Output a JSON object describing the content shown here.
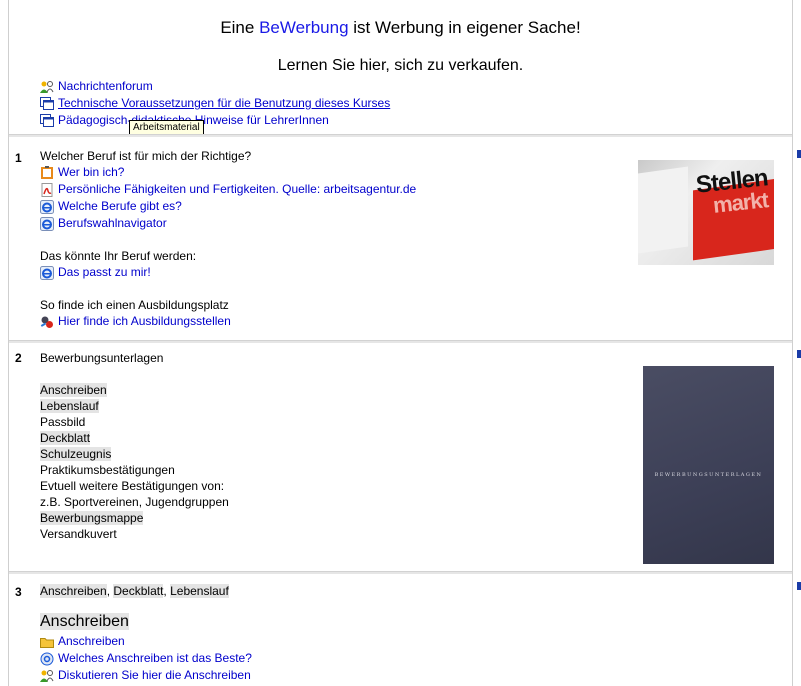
{
  "header": {
    "title_pre": "Eine ",
    "title_brand": "BeWerbung",
    "title_post": " ist Werbung in eigener Sache!",
    "subtitle": "Lernen Sie hier, sich zu verkaufen."
  },
  "intro_links": [
    {
      "label": "Nachrichtenforum",
      "icon": "forum-icon"
    },
    {
      "label": "Technische Voraussetzungen für die Benutzung dieses Kurses",
      "icon": "window-icon"
    },
    {
      "label": "Pädagogisch-didaktische Hinweise für LehrerInnen",
      "icon": "window-icon"
    }
  ],
  "tooltip": "Arbeitsmaterial",
  "section1": {
    "number": "1",
    "heading": "Welcher Beruf ist für mich der Richtige?",
    "links_a": [
      {
        "label": "Wer bin ich?",
        "icon": "clipboard-icon"
      },
      {
        "label": "Persönliche Fähigkeiten und Fertigkeiten. Quelle: arbeitsagentur.de",
        "icon": "pdf-icon"
      },
      {
        "label": "Welche Berufe gibt es?",
        "icon": "ie-icon"
      },
      {
        "label": "Berufswahlnavigator",
        "icon": "ie-icon"
      }
    ],
    "label_b": "Das könnte Ihr Beruf werden:",
    "link_b": "Das passt zu mir!",
    "label_c": "So finde ich einen Ausbildungsplatz",
    "link_c": "Hier finde ich Ausbildungsstellen",
    "image_text_1": "Stellen",
    "image_text_2": "markt"
  },
  "section2": {
    "number": "2",
    "heading": "Bewerbungsunterlagen",
    "items": [
      {
        "text": "Anschreiben",
        "hl": true
      },
      {
        "text": "Lebenslauf",
        "hl": true
      },
      {
        "text": "Passbild",
        "hl": false
      },
      {
        "text": "Deckblatt",
        "hl": true
      },
      {
        "text": "Schulzeugnis",
        "hl": true
      },
      {
        "text": "Praktikumsbestätigungen",
        "hl": false
      },
      {
        "text": "Evtuell weitere Bestätigungen von:",
        "hl": false
      },
      {
        "text": "z.B. Sportvereinen, Jugendgruppen",
        "hl": false
      },
      {
        "text": "Bewerbungsmappe",
        "hl": true
      },
      {
        "text": "Versandkuvert",
        "hl": false
      }
    ],
    "image_caption": "BEWERBUNGSUNTERLAGEN"
  },
  "section3": {
    "number": "3",
    "heading_parts": [
      "Anschreiben",
      ", ",
      "Deckblatt",
      ", ",
      "Lebenslauf"
    ],
    "subheading": "Anschreiben",
    "links": [
      {
        "label": "Anschreiben",
        "icon": "folder-icon"
      },
      {
        "label": "Welches Anschreiben ist das Beste?",
        "icon": "choice-icon"
      },
      {
        "label": "Diskutieren Sie hier die Anschreiben",
        "icon": "forum-icon"
      }
    ]
  },
  "colors": {
    "link": "#0000cc",
    "brand": "#1a1ae6",
    "highlight": "#e4e4e4"
  }
}
